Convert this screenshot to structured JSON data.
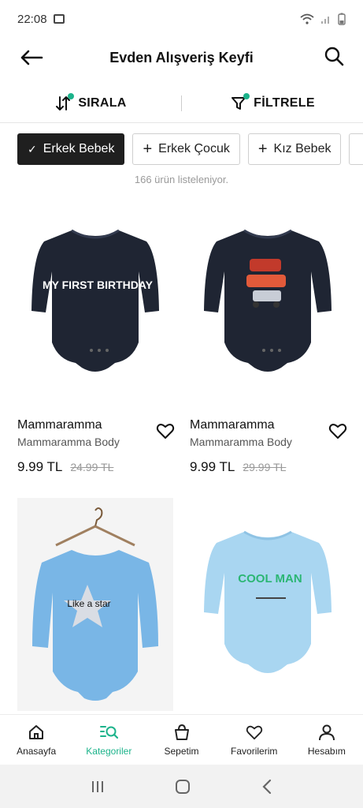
{
  "status": {
    "time": "22:08"
  },
  "header": {
    "title": "Evden Alışveriş Keyfi"
  },
  "toolbar": {
    "sort_label": "SIRALA",
    "filter_label": "FİLTRELE"
  },
  "chips": [
    {
      "label": "Erkek Bebek",
      "active": true
    },
    {
      "label": "Erkek Çocuk",
      "active": false
    },
    {
      "label": "Kız Bebek",
      "active": false
    }
  ],
  "result_count": "166 ürün listeleniyor.",
  "products": [
    {
      "brand": "Mammaramma",
      "name": "Mammaramma Body",
      "price": "9.99 TL",
      "old_price": "24.99 TL",
      "print_text": "MY FIRST BIRTHDAY"
    },
    {
      "brand": "Mammaramma",
      "name": "Mammaramma Body",
      "price": "9.99 TL",
      "old_price": "29.99 TL",
      "print_text": ""
    },
    {
      "brand": "",
      "name": "",
      "price": "",
      "old_price": "",
      "print_text": "Like a star"
    },
    {
      "brand": "",
      "name": "",
      "price": "",
      "old_price": "",
      "print_text": "COOL MAN"
    }
  ],
  "bottom_nav": [
    {
      "label": "Anasayfa",
      "icon": "home-icon"
    },
    {
      "label": "Kategoriler",
      "icon": "categories-search-icon",
      "active": true
    },
    {
      "label": "Sepetim",
      "icon": "basket-icon"
    },
    {
      "label": "Favorilerim",
      "icon": "heart-icon"
    },
    {
      "label": "Hesabım",
      "icon": "user-icon"
    }
  ],
  "colors": {
    "accent": "#1cb38b",
    "chip_active_bg": "#1f1f1f",
    "navy_garment": "#1f2533",
    "blue_garment": "#79b6e6",
    "light_blue_garment": "#a9d6f1"
  }
}
